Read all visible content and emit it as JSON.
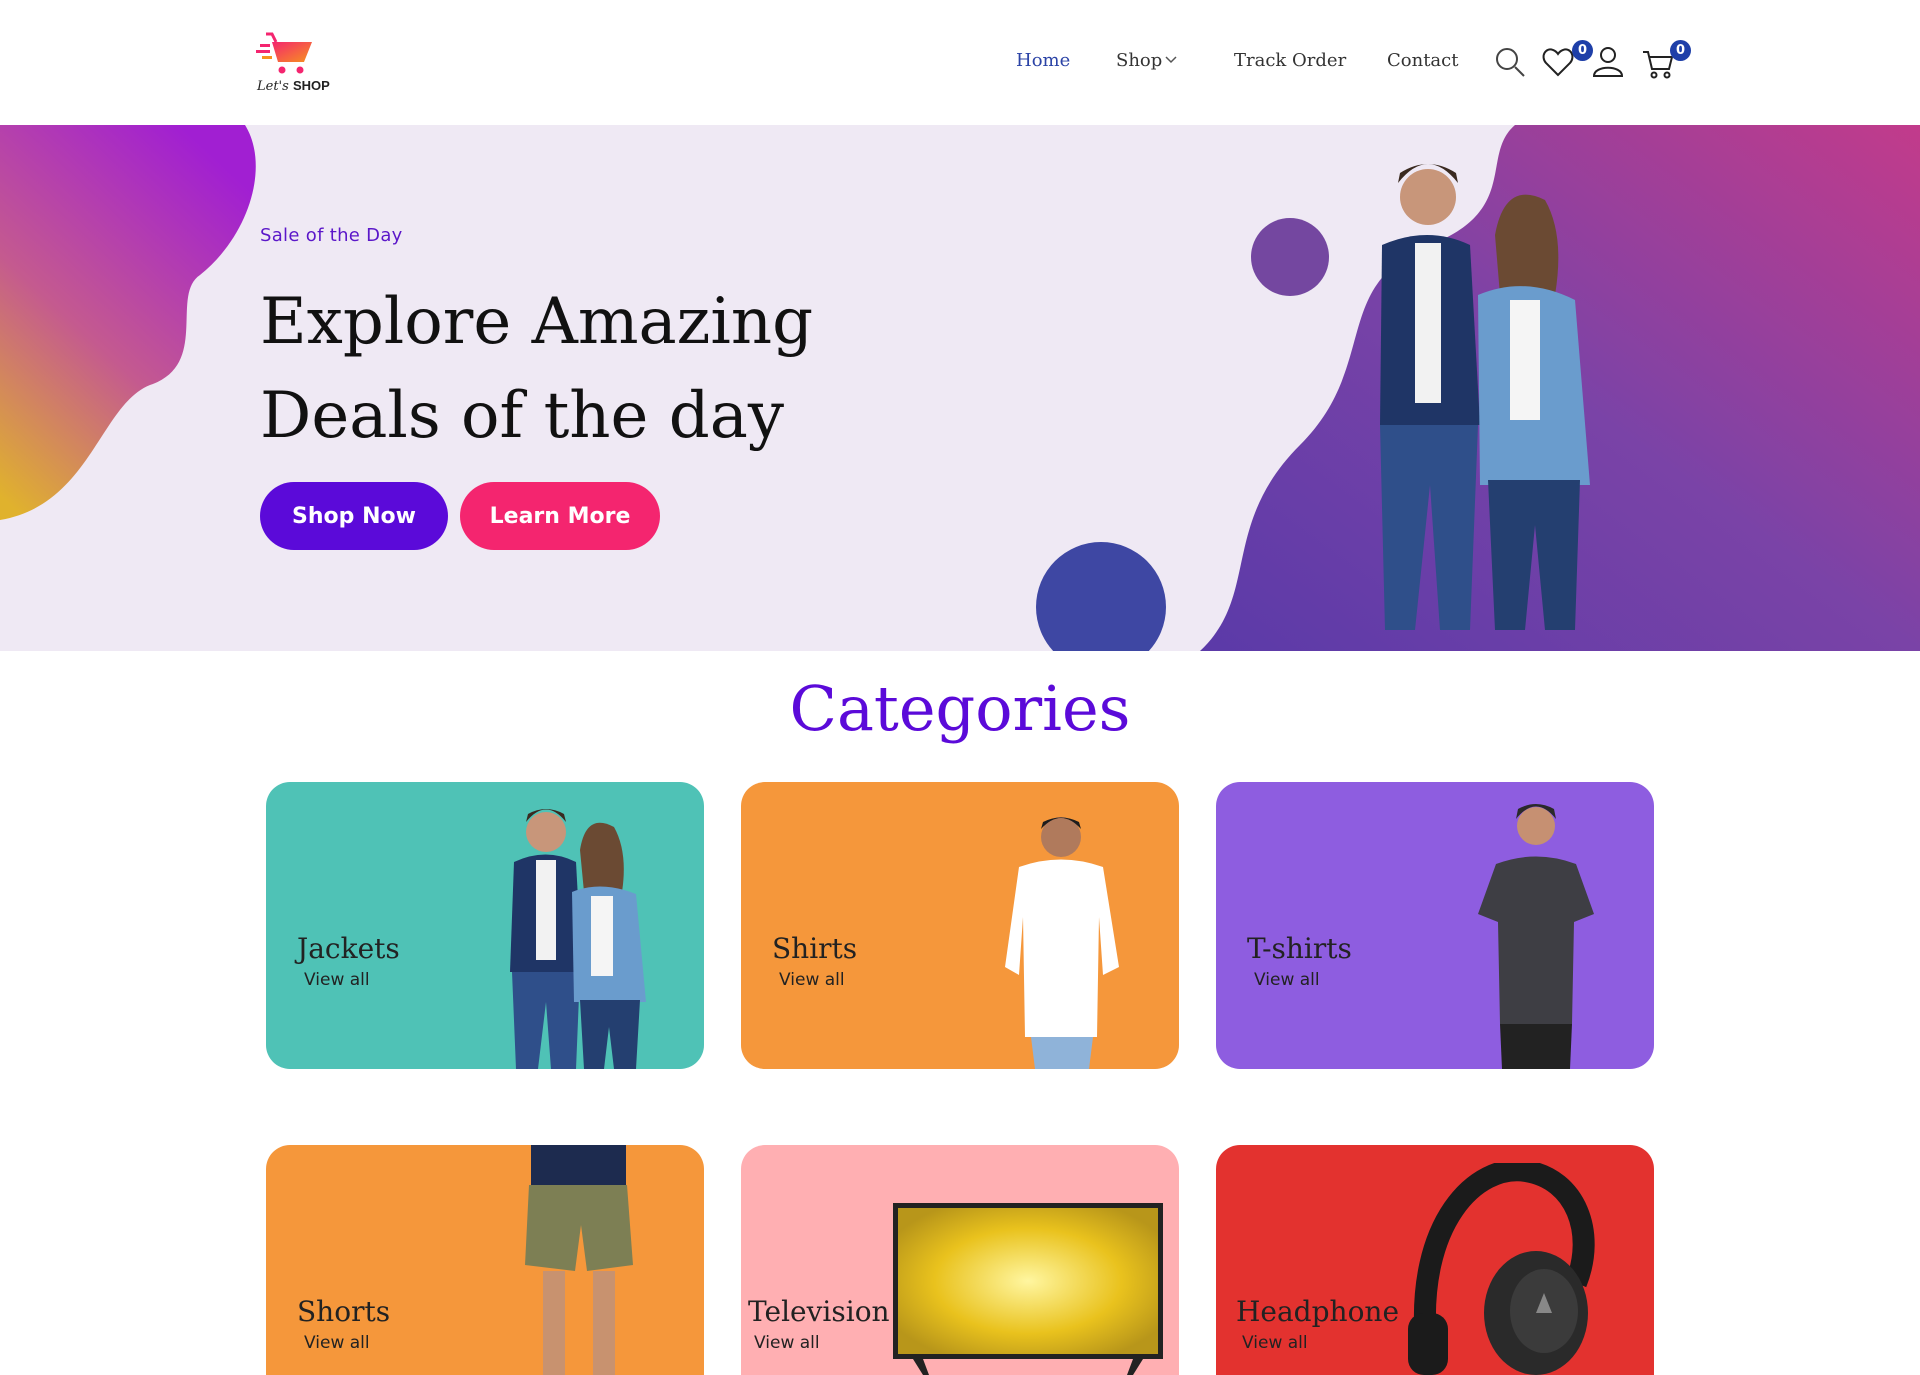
{
  "brand": {
    "logo_script": "Let's",
    "logo_bold": "SHOP"
  },
  "nav": {
    "home": "Home",
    "shop": "Shop",
    "track": "Track Order",
    "contact": "Contact"
  },
  "header_icons": {
    "wishlist_count": "0",
    "cart_count": "0"
  },
  "hero": {
    "eyebrow": "Sale of the Day",
    "title_line1": "Explore Amazing",
    "title_line2": "Deals of the day",
    "shop_now": "Shop Now",
    "learn_more": "Learn More"
  },
  "categories": {
    "heading": "Categories",
    "items": [
      {
        "name": "Jackets",
        "link": "View all",
        "color": "#4fc2b6"
      },
      {
        "name": "Shirts",
        "link": "View all",
        "color": "#f5973b"
      },
      {
        "name": "T-shirts",
        "link": "View all",
        "color": "#8e5de0"
      },
      {
        "name": "Shorts",
        "link": "View all",
        "color": "#f5973b"
      },
      {
        "name": "Television",
        "link": "View all",
        "color": "#ffafb2"
      },
      {
        "name": "Headphone",
        "link": "View all",
        "color": "#e3322f"
      }
    ]
  },
  "colors": {
    "primary": "#5b0ad9",
    "accent": "#f4256f",
    "nav_active": "#2b43a6",
    "badge": "#1e3fa8"
  }
}
